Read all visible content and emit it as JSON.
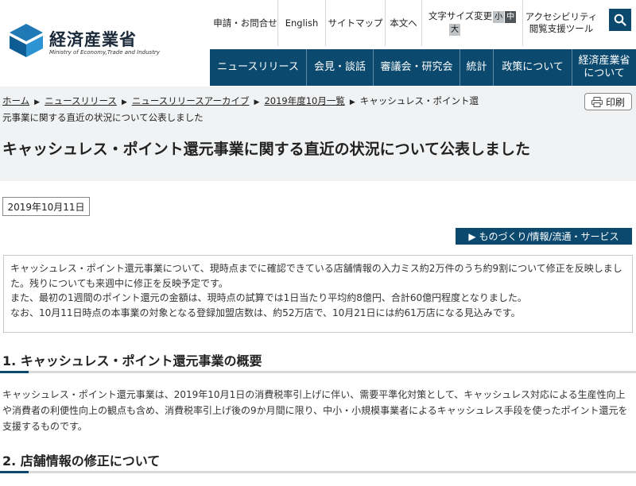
{
  "header": {
    "logo_title": "経済産業省",
    "logo_subtitle": "Ministry of Economy,Trade and Industry",
    "util_links": {
      "inquiry": "申請・お問合せ",
      "english": "English",
      "sitemap": "サイトマップ",
      "body": "本文へ",
      "font_size_label": "文字サイズ変更",
      "font_small": "小",
      "font_medium": "中",
      "font_large": "大",
      "accessibility": "アクセシビリティ閲覧支援ツール"
    },
    "search_icon": "search-icon"
  },
  "nav": [
    {
      "label": "ニュースリリース"
    },
    {
      "label": "会見・談話"
    },
    {
      "label": "審議会・研究会"
    },
    {
      "label": "統計"
    },
    {
      "label": "政策について"
    },
    {
      "label": "経済産業省について"
    }
  ],
  "breadcrumb": {
    "home": "ホーム",
    "news": "ニュースリリース",
    "archive": "ニュースリリースアーカイブ",
    "month": "2019年度10月一覧",
    "current": "キャッシュレス・ポイント還元事業に関する直近の状況について公表しました",
    "separator": "▶"
  },
  "print_label": "印刷",
  "page_title": "キャッシュレス・ポイント還元事業に関する直近の状況について公表しました",
  "date": "2019年10月11日",
  "category": "▶ ものづくり/情報/流通・サービス",
  "summary": [
    "キャッシュレス・ポイント還元事業について、現時点までに確認できている店舗情報の入力ミス約2万件のうち約9割について修正を反映しました。残りについても来週中に修正を反映予定です。",
    "また、最初の1週間のポイント還元の金額は、現時点の試算では1日当たり平均約8億円、合計60億円程度となりました。",
    "なお、10月11日時点の本事業の対象となる登録加盟店数は、約52万店で、10月21日には約61万店になる見込みです。"
  ],
  "section1": {
    "heading": "1. キャッシュレス・ポイント還元事業の概要",
    "body": "キャッシュレス・ポイント還元事業は、2019年10月1日の消費税率引上げに伴い、需要平準化対策として、キャッシュレス対応による生産性向上や消費者の利便性向上の観点も含め、消費税率引上げ後の9か月間に限り、中小・小規模事業者によるキャッシュレス手段を使ったポイント還元を支援するものです。"
  },
  "section2": {
    "heading": "2. 店舗情報の修正について"
  },
  "colors": {
    "brand": "#0b4a6e",
    "band": "#f1f2f3"
  }
}
